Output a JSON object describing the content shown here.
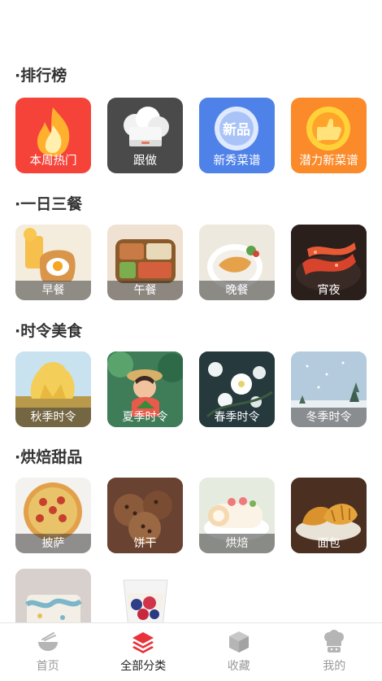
{
  "sections": {
    "ranking": {
      "title": "·排行榜",
      "items": [
        {
          "label": "本周热门",
          "icon": "flame-icon",
          "bg": "#f5433a"
        },
        {
          "label": "跟做",
          "icon": "chef-hat-icon",
          "bg": "#4a4a4a"
        },
        {
          "label": "新秀菜谱",
          "icon": "new-badge-icon",
          "bg": "#4f82e8"
        },
        {
          "label": "潜力新菜谱",
          "icon": "thumbs-up-icon",
          "bg": "#fb8a2a"
        }
      ]
    },
    "meals": {
      "title": "·一日三餐",
      "items": [
        {
          "label": "早餐"
        },
        {
          "label": "午餐"
        },
        {
          "label": "晚餐"
        },
        {
          "label": "宵夜"
        }
      ]
    },
    "seasonal": {
      "title": "·时令美食",
      "items": [
        {
          "label": "秋季时令"
        },
        {
          "label": "夏季时令"
        },
        {
          "label": "春季时令"
        },
        {
          "label": "冬季时令"
        }
      ]
    },
    "baking": {
      "title": "·烘焙甜品",
      "items": [
        {
          "label": "披萨"
        },
        {
          "label": "饼干"
        },
        {
          "label": "烘焙"
        },
        {
          "label": "面包"
        }
      ]
    }
  },
  "tabbar": {
    "items": [
      {
        "label": "首页",
        "icon": "bowl-icon",
        "active": false
      },
      {
        "label": "全部分类",
        "icon": "layers-icon",
        "active": true
      },
      {
        "label": "收藏",
        "icon": "box-icon",
        "active": false
      },
      {
        "label": "我的",
        "icon": "chef-icon",
        "active": false
      }
    ],
    "active_color": "#e8333a",
    "inactive_color": "#b5b5b5"
  }
}
